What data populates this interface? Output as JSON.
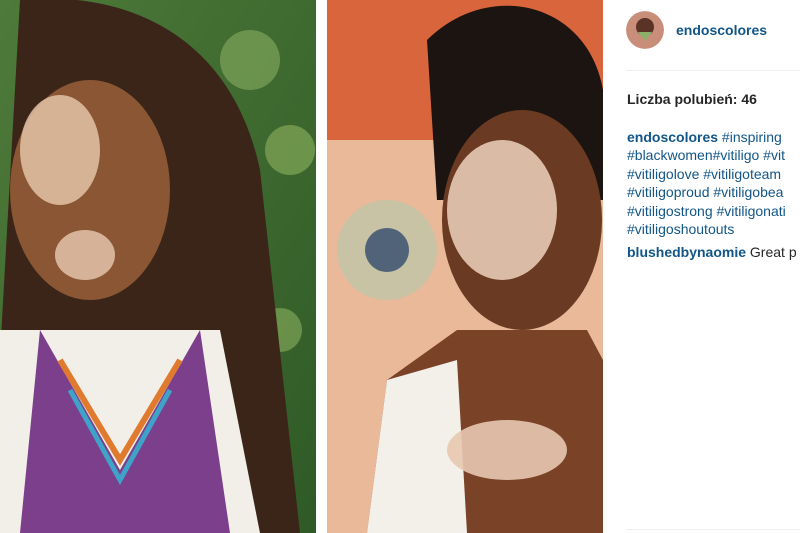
{
  "post": {
    "username": "endoscolores",
    "likes_text": "Liczba polubień: 46",
    "caption": {
      "author": "endoscolores",
      "lines": [
        "#inspiring",
        "#blackwomen#vitiligo #vit",
        "#vitiligolove #vitiligoteam",
        "#vitiligoproud #vitiligobea",
        "#vitiligostrong #vitiligonati",
        "#vitiligoshoutouts"
      ]
    },
    "comment": {
      "author": "blushedbynaomie",
      "text": " Great p"
    }
  },
  "colors": {
    "link": "#125688",
    "text": "#262626",
    "divider": "#efefef"
  },
  "icons": {
    "avatar": "profile-avatar"
  }
}
